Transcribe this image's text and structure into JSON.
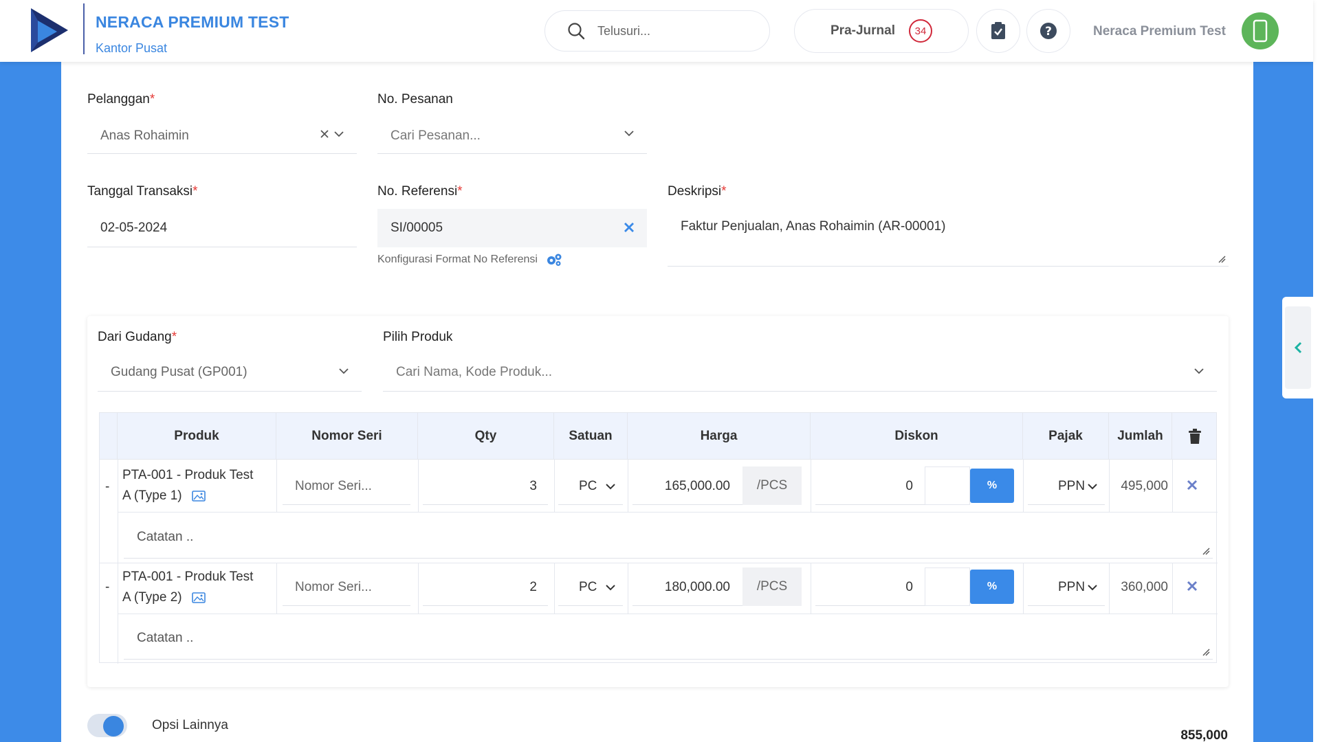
{
  "header": {
    "company_name": "NERACA PREMIUM TEST",
    "branch": "Kantor Pusat",
    "search_placeholder": "Telusuri...",
    "pra_jurnal_label": "Pra-Jurnal",
    "pra_jurnal_count": "34",
    "user_name": "Neraca Premium Test"
  },
  "colors": {
    "brand": "#3a86e0",
    "accent": "#3a8ae8",
    "required": "#e53935",
    "badge": "#d0283a",
    "avatar": "#5db55a"
  },
  "form": {
    "pelanggan": {
      "label": "Pelanggan",
      "value": "Anas Rohaimin"
    },
    "no_pesanan": {
      "label": "No. Pesanan",
      "placeholder": "Cari Pesanan..."
    },
    "tanggal": {
      "label": "Tanggal Transaksi",
      "value": "02-05-2024"
    },
    "no_referensi": {
      "label": "No. Referensi",
      "value": "SI/00005",
      "hint": "Konfigurasi Format No Referensi"
    },
    "deskripsi": {
      "label": "Deskripsi",
      "value": "Faktur Penjualan, Anas Rohaimin (AR-00001)"
    },
    "required_mark": "*"
  },
  "product_section": {
    "gudang": {
      "label": "Dari Gudang",
      "value": "Gudang Pusat (GP001)"
    },
    "pilih_produk": {
      "label": "Pilih Produk",
      "placeholder": "Cari Nama, Kode Produk..."
    }
  },
  "table": {
    "headers": {
      "produk": "Produk",
      "nomor_seri": "Nomor Seri",
      "qty": "Qty",
      "satuan": "Satuan",
      "harga": "Harga",
      "diskon": "Diskon",
      "pajak": "Pajak",
      "jumlah": "Jumlah"
    },
    "rows": [
      {
        "toggle": "-",
        "product_line1": "PTA-001 - Produk Test",
        "product_line2": "A (Type 1)",
        "serial_placeholder": "Nomor Seri...",
        "qty": "3",
        "satuan": "PC",
        "harga": "165,000.00",
        "unit": "/PCS",
        "diskon": "0",
        "diskon_type": "%",
        "pajak": "PPN",
        "jumlah": "495,000",
        "note_placeholder": "Catatan .."
      },
      {
        "toggle": "-",
        "product_line1": "PTA-001 - Produk Test",
        "product_line2": "A (Type 2)",
        "serial_placeholder": "Nomor Seri...",
        "qty": "2",
        "satuan": "PC",
        "harga": "180,000.00",
        "unit": "/PCS",
        "diskon": "0",
        "diskon_type": "%",
        "pajak": "PPN",
        "jumlah": "360,000",
        "note_placeholder": "Catatan .."
      }
    ]
  },
  "footer": {
    "opsi_label": "Opsi Lainnya",
    "total": "855,000"
  }
}
